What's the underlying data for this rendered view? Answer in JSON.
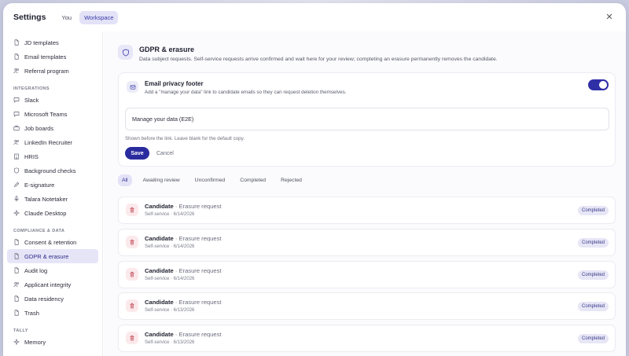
{
  "header": {
    "title": "Settings",
    "tabs": [
      {
        "label": "You"
      },
      {
        "label": "Workspace"
      }
    ],
    "close_glyph": "✕"
  },
  "sidebar": {
    "group0": [
      {
        "label": "JD templates",
        "icon": "file-icon"
      },
      {
        "label": "Email templates",
        "icon": "file-icon"
      },
      {
        "label": "Referral program",
        "icon": "users-icon"
      }
    ],
    "integrations_label": "INTEGRATIONS",
    "integrations": [
      {
        "label": "Slack",
        "icon": "chat-icon"
      },
      {
        "label": "Microsoft Teams",
        "icon": "chat-icon"
      },
      {
        "label": "Job boards",
        "icon": "briefcase-icon"
      },
      {
        "label": "LinkedIn Recruiter",
        "icon": "users-icon"
      },
      {
        "label": "HRIS",
        "icon": "building-icon"
      },
      {
        "label": "Background checks",
        "icon": "shield-icon"
      },
      {
        "label": "E-signature",
        "icon": "pen-icon"
      },
      {
        "label": "Talara Notetaker",
        "icon": "mic-icon"
      },
      {
        "label": "Claude Desktop",
        "icon": "sparkle-icon"
      }
    ],
    "compliance_label": "COMPLIANCE & DATA",
    "compliance": [
      {
        "label": "Consent & retention",
        "icon": "file-icon"
      },
      {
        "label": "GDPR & erasure",
        "icon": "file-icon"
      },
      {
        "label": "Audit log",
        "icon": "file-icon"
      },
      {
        "label": "Applicant integrity",
        "icon": "users-icon"
      },
      {
        "label": "Data residency",
        "icon": "file-icon"
      },
      {
        "label": "Trash",
        "icon": "file-icon"
      }
    ],
    "tally_label": "TALLY",
    "tally": [
      {
        "label": "Memory",
        "icon": "sparkle-icon"
      }
    ]
  },
  "section": {
    "title": "GDPR & erasure",
    "description": "Data subject requests. Self-service requests arrive confirmed and wait here for your review; completing an erasure permanently removes the candidate."
  },
  "footer_card": {
    "title": "Email privacy footer",
    "description": "Add a \"manage your data\" link to candidate emails so they can request deletion themselves.",
    "enabled": true,
    "input_value": "Manage your data (E2E)",
    "hint": "Shown before the link. Leave blank for the default copy.",
    "save_label": "Save",
    "cancel_label": "Cancel"
  },
  "filters": [
    {
      "label": "All"
    },
    {
      "label": "Awaiting review"
    },
    {
      "label": "Unconfirmed"
    },
    {
      "label": "Completed"
    },
    {
      "label": "Rejected"
    }
  ],
  "requests": [
    {
      "who": "Candidate",
      "sep": " · ",
      "kind": "Erasure request",
      "sub": "Self-service · 6/14/2026",
      "status": "Completed"
    },
    {
      "who": "Candidate",
      "sep": " · ",
      "kind": "Erasure request",
      "sub": "Self-service · 6/14/2026",
      "status": "Completed"
    },
    {
      "who": "Candidate",
      "sep": " · ",
      "kind": "Erasure request",
      "sub": "Self-service · 6/14/2026",
      "status": "Completed"
    },
    {
      "who": "Candidate",
      "sep": " · ",
      "kind": "Erasure request",
      "sub": "Self-service · 6/13/2026",
      "status": "Completed"
    },
    {
      "who": "Candidate",
      "sep": " · ",
      "kind": "Erasure request",
      "sub": "Self-service · 6/13/2026",
      "status": "Completed"
    }
  ],
  "colors": {
    "accent": "#2a2b9e",
    "active_bg": "#e6e5f8",
    "danger_bg": "#fbe9eb",
    "danger": "#c24a5a"
  }
}
